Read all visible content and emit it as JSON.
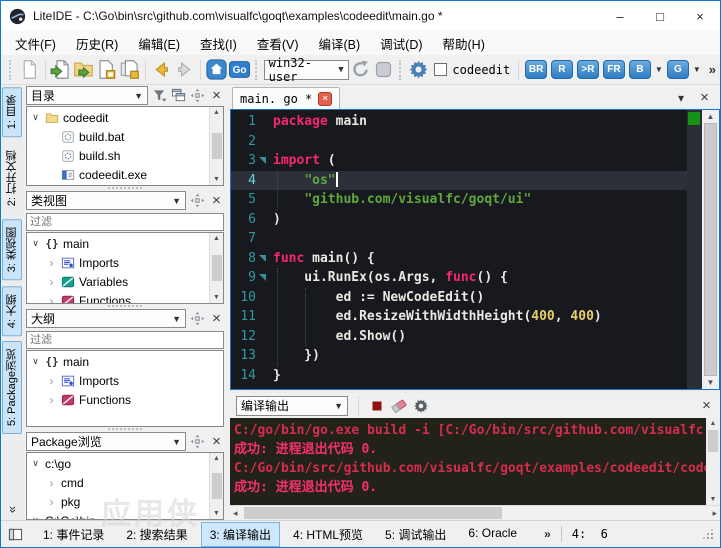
{
  "window": {
    "title": "LiteIDE - C:\\Go\\bin\\src\\github.com\\visualfc\\goqt\\examples\\codeedit\\main.go *",
    "controls": {
      "minimize": "–",
      "maximize": "□",
      "close": "×"
    }
  },
  "menu_bar": {
    "items": [
      "文件(F)",
      "历史(R)",
      "编辑(E)",
      "查找(I)",
      "查看(V)",
      "编译(B)",
      "调试(D)",
      "帮助(H)"
    ]
  },
  "toolbar": {
    "groups": [
      {
        "type": "grip"
      },
      {
        "type": "icons",
        "icons": [
          "new-file-icon"
        ]
      },
      {
        "type": "sep"
      },
      {
        "type": "icons",
        "icons": [
          "open-file-icon",
          "open-folder-icon",
          "save-file-icon",
          "save-all-icon"
        ]
      },
      {
        "type": "sep"
      },
      {
        "type": "icons",
        "icons": [
          "back-icon",
          "forward-icon"
        ]
      },
      {
        "type": "sep"
      },
      {
        "type": "icons",
        "icons": [
          "home-icon",
          "go-badge-icon"
        ]
      },
      {
        "type": "grip"
      },
      {
        "type": "combo",
        "value": "win32-user"
      },
      {
        "type": "icons",
        "icons": [
          "reload-icon",
          "stop-icon"
        ]
      },
      {
        "type": "grip"
      },
      {
        "type": "icons",
        "icons": [
          "gear-icon"
        ]
      },
      {
        "type": "checkbox",
        "checked": false,
        "label": "codeedit"
      },
      {
        "type": "sep"
      },
      {
        "type": "build_buttons",
        "buttons": [
          {
            "label": "BR"
          },
          {
            "label": "R"
          },
          {
            "label": ">R"
          },
          {
            "label": "FR"
          },
          {
            "label": "B",
            "dropdown": true
          },
          {
            "label": "G",
            "dropdown": true
          }
        ]
      },
      {
        "type": "overflow",
        "label": "»"
      }
    ]
  },
  "side_tabs": {
    "items": [
      {
        "label": "1: 目录",
        "active": true
      },
      {
        "label": "2: 打开文档",
        "active": false
      },
      {
        "label": "3: 类视图",
        "active": true
      },
      {
        "label": "4: 大纲",
        "active": true
      },
      {
        "label": "5: Package浏览",
        "active": true
      }
    ],
    "collapse_label": "«"
  },
  "panels": [
    {
      "title": "目录",
      "header_icons": [
        "filter-icon",
        "cascade-icon",
        "dock-icon",
        "close-icon"
      ],
      "filter_placeholder": null,
      "scrollbar": true,
      "tree": [
        {
          "label": "codeedit",
          "icon": "folder-icon",
          "marker": "open",
          "level": 0
        },
        {
          "label": "build.bat",
          "icon": "script-file-icon",
          "marker": "none",
          "level": 1
        },
        {
          "label": "build.sh",
          "icon": "script-file-icon",
          "marker": "none",
          "level": 1
        },
        {
          "label": "codeedit.exe",
          "icon": "exe-file-icon",
          "marker": "none",
          "level": 1
        }
      ]
    },
    {
      "title": "类视图",
      "header_icons": [
        "dock-icon",
        "close-icon"
      ],
      "filter_placeholder": "过滤",
      "scrollbar": true,
      "tree": [
        {
          "label": "main",
          "icon": "braces-icon",
          "marker": "open",
          "level": 0
        },
        {
          "label": "Imports",
          "icon": "imports-icon",
          "marker": "chev",
          "level": 1
        },
        {
          "label": "Variables",
          "icon": "variables-icon",
          "marker": "chev",
          "level": 1
        },
        {
          "label": "Functions",
          "icon": "functions-icon",
          "marker": "chev",
          "level": 1
        }
      ]
    },
    {
      "title": "大纲",
      "header_icons": [
        "dock-icon",
        "close-icon"
      ],
      "filter_placeholder": "过滤",
      "scrollbar": false,
      "tree": [
        {
          "label": "main",
          "icon": "braces-icon",
          "marker": "open",
          "level": 0
        },
        {
          "label": "Imports",
          "icon": "imports-icon",
          "marker": "chev",
          "level": 1
        },
        {
          "label": "Functions",
          "icon": "functions-icon",
          "marker": "chev",
          "level": 1
        }
      ]
    },
    {
      "title": "Package浏览",
      "header_icons": [
        "dock-icon",
        "close-icon"
      ],
      "filter_placeholder": null,
      "scrollbar": true,
      "tree": [
        {
          "label": "c:\\go",
          "icon": null,
          "marker": "open",
          "level": 0
        },
        {
          "label": "cmd",
          "icon": null,
          "marker": "chev",
          "level": 1
        },
        {
          "label": "pkg",
          "icon": null,
          "marker": "chev",
          "level": 1
        },
        {
          "label": "C:\\Go\\bin",
          "icon": null,
          "marker": "open",
          "level": 0
        }
      ]
    }
  ],
  "editor": {
    "tab_label": "main. go *",
    "lines": [
      {
        "n": 1,
        "segs": [
          [
            "kw",
            "package"
          ],
          [
            "pl",
            " main"
          ]
        ]
      },
      {
        "n": 2,
        "segs": []
      },
      {
        "n": 3,
        "fold": true,
        "segs": [
          [
            "kw",
            "import"
          ],
          [
            "pl",
            " ("
          ]
        ]
      },
      {
        "n": 4,
        "current": true,
        "cursor": true,
        "segs": [
          [
            "pl",
            "    "
          ],
          [
            "str",
            "\"os\""
          ]
        ]
      },
      {
        "n": 5,
        "segs": [
          [
            "pl",
            "    "
          ],
          [
            "str",
            "\"github.com/visualfc/goqt/ui\""
          ]
        ]
      },
      {
        "n": 6,
        "segs": [
          [
            "pl",
            ")"
          ]
        ]
      },
      {
        "n": 7,
        "segs": []
      },
      {
        "n": 8,
        "fold": true,
        "segs": [
          [
            "kw",
            "func"
          ],
          [
            "pl",
            " main() {"
          ]
        ]
      },
      {
        "n": 9,
        "fold": true,
        "segs": [
          [
            "pl",
            "    ui.RunEx(os.Args, "
          ],
          [
            "kw",
            "func"
          ],
          [
            "pl",
            "() {"
          ]
        ]
      },
      {
        "n": 10,
        "segs": [
          [
            "pl",
            "        ed := NewCodeEdit()"
          ]
        ]
      },
      {
        "n": 11,
        "segs": [
          [
            "pl",
            "        ed.ResizeWithWidthHeight("
          ],
          [
            "num",
            "400"
          ],
          [
            "pl",
            ", "
          ],
          [
            "num",
            "400"
          ],
          [
            "pl",
            ")"
          ]
        ]
      },
      {
        "n": 12,
        "segs": [
          [
            "pl",
            "        ed.Show()"
          ]
        ]
      },
      {
        "n": 13,
        "segs": [
          [
            "pl",
            "    })"
          ]
        ]
      },
      {
        "n": 14,
        "segs": [
          [
            "pl",
            "}"
          ]
        ]
      }
    ]
  },
  "output": {
    "combo_label": "编译输出",
    "header_icons": [
      "stop-red-icon",
      "eraser-icon",
      "gear-dark-icon"
    ],
    "lines": [
      {
        "kind": "cmd",
        "text": "C:/go/bin/go.exe build -i [C:/Go/bin/src/github.com/visualfc"
      },
      {
        "kind": "ok",
        "text": "成功: 进程退出代码 0."
      },
      {
        "kind": "cmd",
        "text": "C:/Go/bin/src/github.com/visualfc/goqt/examples/codeedit/code"
      },
      {
        "kind": "ok",
        "text": "成功: 进程退出代码 0."
      }
    ]
  },
  "status_bar": {
    "tabs": [
      {
        "label": "1: 事件记录",
        "active": false
      },
      {
        "label": "2: 搜索结果",
        "active": false
      },
      {
        "label": "3: 编译输出",
        "active": true
      },
      {
        "label": "4: HTML预览",
        "active": false
      },
      {
        "label": "5: 调试输出",
        "active": false
      },
      {
        "label": "6: Oracle",
        "active": false
      }
    ],
    "overflow": "»",
    "cursor_position": "4:  6"
  },
  "watermark": {
    "text": "应用侠"
  },
  "colors": {
    "accent_blue": "#2f7fd0",
    "keyword": "#f7276f",
    "string": "#5fa83d",
    "number": "#e9cd6a",
    "line_number": "#2f9aa2",
    "editor_bg": "#17191e",
    "output_command": "#d52c50",
    "output_success": "#f5306e",
    "marker_green": "#169316"
  }
}
